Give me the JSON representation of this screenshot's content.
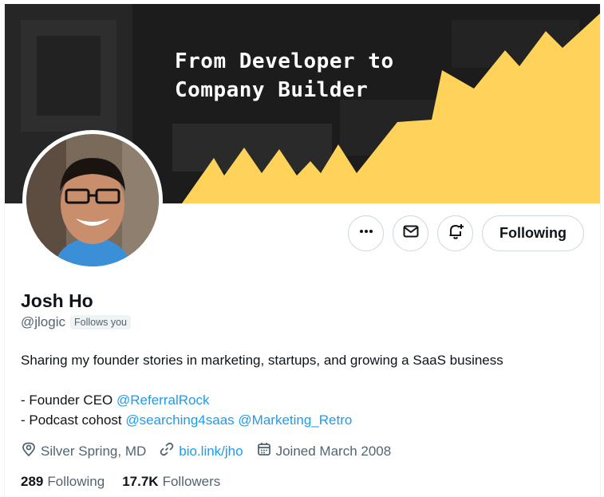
{
  "banner": {
    "title": "From Developer to\nCompany Builder",
    "colors": {
      "background": "#1c1c1c",
      "mountains": "#ffd25a"
    }
  },
  "avatar": {
    "icon": "profile-photo"
  },
  "actions": {
    "more_icon": "more-icon",
    "message_icon": "mail-icon",
    "notify_icon": "bell-plus-icon",
    "following_label": "Following"
  },
  "profile": {
    "name": "Josh Ho",
    "handle": "@jlogic",
    "follows_you": "Follows you"
  },
  "bio": {
    "line1": "Sharing my founder stories in marketing, startups, and growing a SaaS business",
    "line2_prefix": "- Founder CEO ",
    "line2_link": "@ReferralRock",
    "line3_prefix": "- Podcast cohost ",
    "line3_link1": "@searching4saas",
    "line3_link2": "@Marketing_Retro"
  },
  "meta": {
    "location": "Silver Spring, MD",
    "website": "bio.link/jho",
    "joined": "Joined March 2008"
  },
  "stats": {
    "following_count": "289",
    "following_label": "Following",
    "followers_count": "17.7K",
    "followers_label": "Followers"
  },
  "colors": {
    "accent": "#1d9bf0",
    "secondary_text": "#536471",
    "primary_text": "#0f1419"
  }
}
